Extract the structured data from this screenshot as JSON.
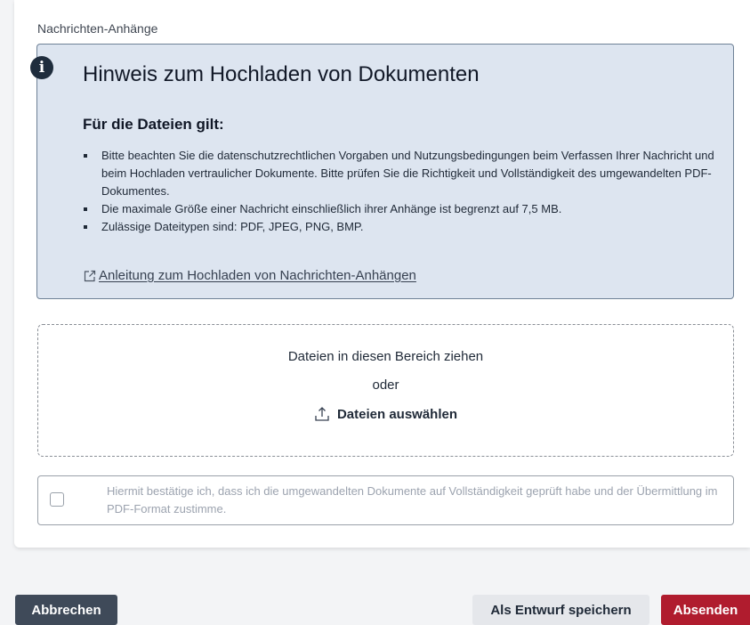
{
  "attachments": {
    "section_label": "Nachrichten-Anhänge",
    "info": {
      "icon": "info-icon",
      "title": "Hinweis zum Hochladen von Dokumenten",
      "subtitle": "Für die Dateien gilt:",
      "items": [
        "Bitte beachten Sie die datenschutzrechtlichen Vorgaben und Nutzungsbedingungen beim Verfassen Ihrer Nachricht und beim Hochladen vertraulicher Dokumente. Bitte prüfen Sie die Richtigkeit und Vollständigkeit des umgewandelten PDF-Dokumentes.",
        "Die maximale Größe einer Nachricht einschließlich ihrer Anhänge ist begrenzt auf 7,5 MB.",
        "Zulässige Dateitypen sind: PDF, JPEG, PNG, BMP."
      ],
      "link_icon": "external-link-icon",
      "link_label": "Anleitung zum Hochladen von Nachrichten-Anhängen"
    },
    "dropzone": {
      "drag_text": "Dateien in diesen Bereich ziehen",
      "or_text": "oder",
      "select_icon": "upload-icon",
      "select_label": "Dateien auswählen"
    },
    "confirmation": {
      "checked": false,
      "text": "Hiermit bestätige ich, dass ich die umgewandelten Dokumente auf Vollständigkeit geprüft habe und der Übermittlung im PDF-Format zustimme."
    }
  },
  "footer": {
    "cancel_label": "Abbrechen",
    "draft_label": "Als Entwurf speichern",
    "send_label": "Absenden"
  },
  "colors": {
    "info_background": "#dde5f0",
    "info_border": "#6e8196",
    "cancel_button": "#3f4a59",
    "draft_button": "#e5e7eb",
    "send_button": "#b01c2e"
  }
}
